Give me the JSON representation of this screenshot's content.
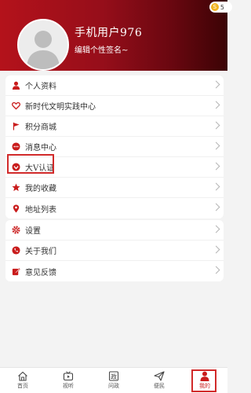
{
  "header": {
    "username": "手机用户976",
    "signature": "编辑个性签名~",
    "coin_count": "5"
  },
  "menu_group_1": [
    {
      "label": "个人资料",
      "icon": "person-icon"
    },
    {
      "label": "新时代文明实践中心",
      "icon": "heart-icon"
    },
    {
      "label": "积分商城",
      "icon": "flag-icon"
    },
    {
      "label": "消息中心",
      "icon": "message-icon"
    },
    {
      "label": "大V认证",
      "icon": "verified-icon"
    },
    {
      "label": "我的收藏",
      "icon": "star-icon"
    },
    {
      "label": "地址列表",
      "icon": "location-icon"
    }
  ],
  "menu_group_2": [
    {
      "label": "设置",
      "icon": "gear-icon"
    },
    {
      "label": "关于我们",
      "icon": "phone-icon"
    },
    {
      "label": "意见反馈",
      "icon": "edit-icon"
    }
  ],
  "tabbar": [
    {
      "label": "首页",
      "icon": "home-icon",
      "active": false
    },
    {
      "label": "视听",
      "icon": "tv-icon",
      "active": false
    },
    {
      "label": "问政",
      "icon": "politics-icon",
      "glyph": "政",
      "active": false
    },
    {
      "label": "便民",
      "icon": "send-icon",
      "active": false
    },
    {
      "label": "我的",
      "icon": "profile-icon",
      "active": true
    }
  ],
  "colors": {
    "accent": "#c91c1c",
    "header_start": "#b4121b",
    "header_end": "#3b0305"
  }
}
